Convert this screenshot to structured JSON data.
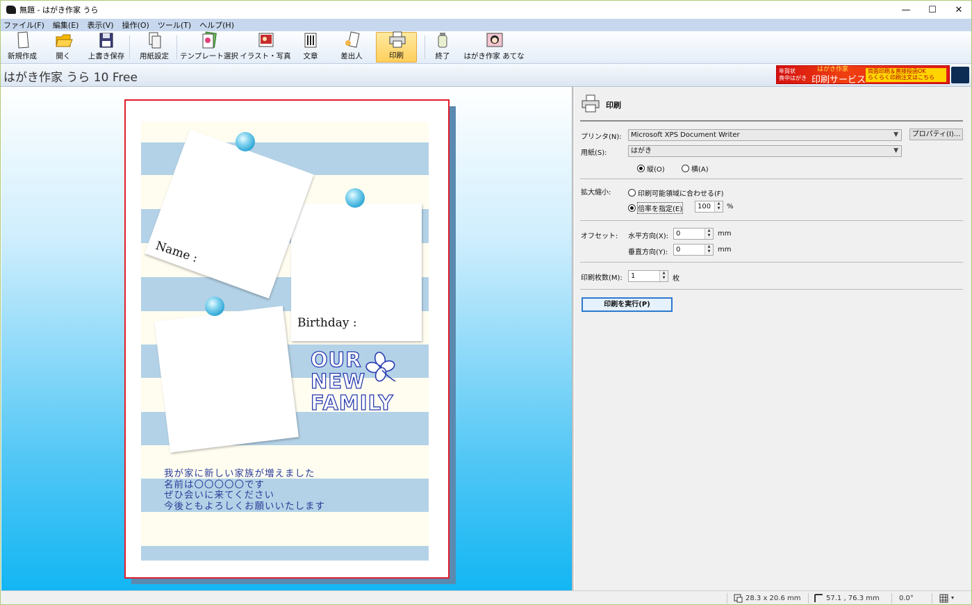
{
  "window": {
    "title": "無題 - はがき作家 うら",
    "minimize": "—",
    "maximize": "☐",
    "close": "✕"
  },
  "menu": [
    "ファイル(F)",
    "編集(E)",
    "表示(V)",
    "操作(O)",
    "ツール(T)",
    "ヘルプ(H)"
  ],
  "toolbar": [
    "新規作成",
    "開く",
    "上書き保存",
    "用紙設定",
    "テンプレート選択",
    "イラスト・写真",
    "文章",
    "差出人",
    "印刷",
    "終了",
    "はがき作家 あてな"
  ],
  "app_title": "はがき作家 うら 10 Free",
  "banner": {
    "line1": "年賀状",
    "line2": "喪中はがき",
    "brand": "はがき作家",
    "service": "印刷サービス",
    "promo1": "両面印刷＆直接投函OK",
    "promo2": "らくらく印刷注文はこちら"
  },
  "card": {
    "name_label": "Name :",
    "birthday_label": "Birthday :",
    "family_line1": "OUR",
    "family_line2": "NEW",
    "family_line3": "FAMILY",
    "message": [
      "我が家に新しい家族が増えました",
      "名前は〇〇〇〇〇です",
      "ぜひ会いに来てください",
      "今後ともよろしくお願いいたします"
    ],
    "border_color": "#e21d2b",
    "stripe_color": "#b4d2e7"
  },
  "print_panel": {
    "title": "印刷",
    "printer_label": "プリンタ(N):",
    "printer_value": "Microsoft XPS Document Writer",
    "properties_button": "プロパティ(I)...",
    "paper_label": "用紙(S):",
    "paper_value": "はがき",
    "orientation_portrait": "縦(O)",
    "orientation_landscape": "横(A)",
    "orientation_selected": "縦(O)",
    "scale_label": "拡大縮小:",
    "fit_option": "印刷可能領域に合わせる(F)",
    "ratio_option": "倍率を指定(E)",
    "ratio_value": "100",
    "ratio_unit": "%",
    "offset_label": "オフセット:",
    "horizontal_label": "水平方向(X):",
    "horizontal_value": "0",
    "vertical_label": "垂直方向(Y):",
    "vertical_value": "0",
    "offset_unit": "mm",
    "copies_label": "印刷枚数(M):",
    "copies_value": "1",
    "copies_unit": "枚",
    "execute_button": "印刷を実行(P)"
  },
  "status": {
    "size": "28.3 x 20.6 mm",
    "position": "57.1 , 76.3 mm",
    "angle": "0.0°"
  },
  "toolbar_active": "印刷"
}
